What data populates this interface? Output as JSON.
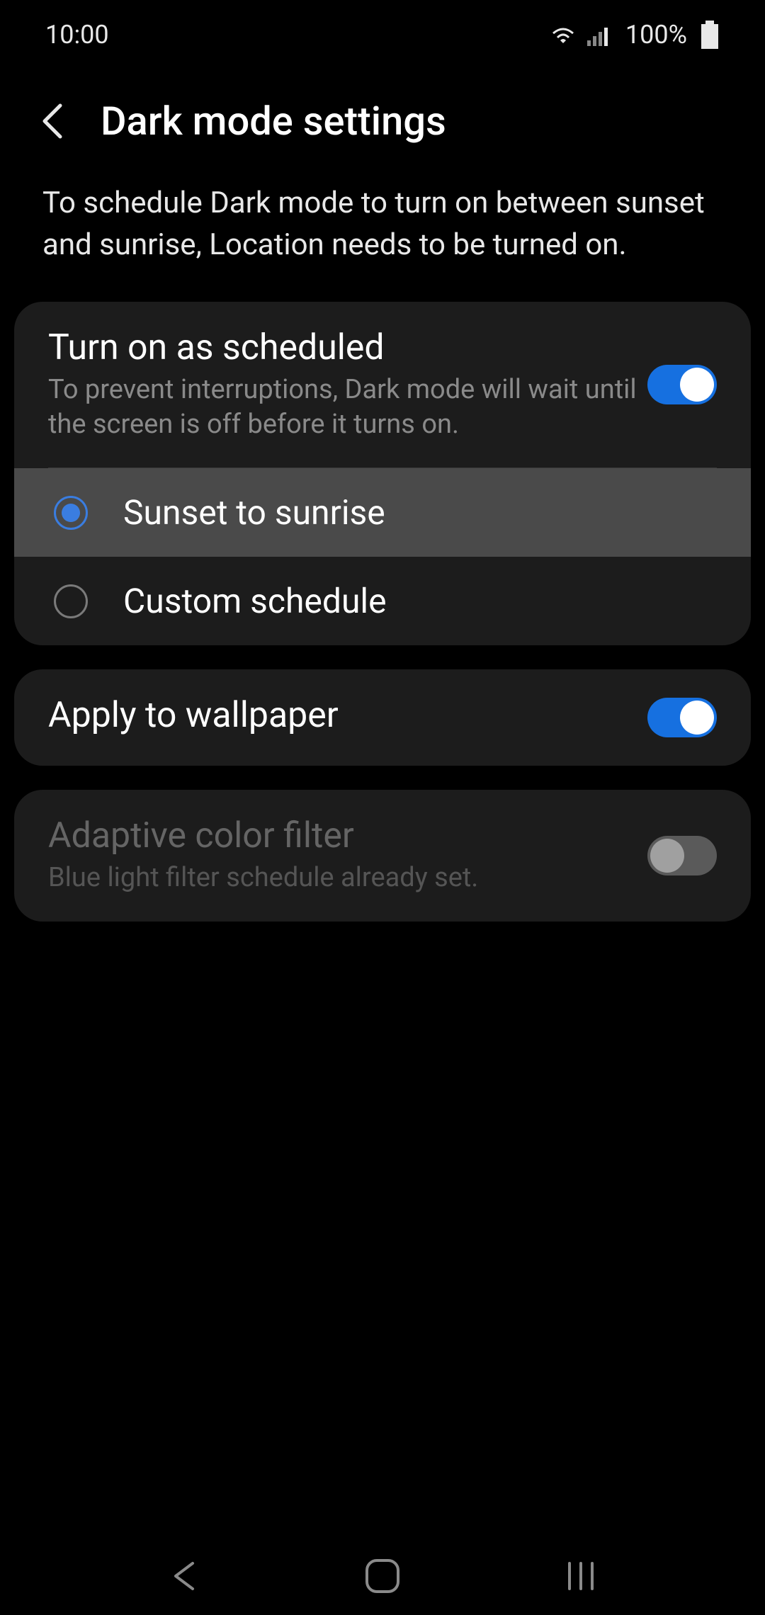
{
  "statusBar": {
    "time": "10:00",
    "battery": "100%"
  },
  "header": {
    "title": "Dark mode settings"
  },
  "info": {
    "text": "To schedule Dark mode to turn on between sunset and sunrise, Location needs to be turned on."
  },
  "scheduleCard": {
    "title": "Turn on as scheduled",
    "subtitle": "To prevent interruptions, Dark mode will wait until the screen is off before it turns on.",
    "enabled": true,
    "options": {
      "sunsetSunrise": {
        "label": "Sunset to sunrise",
        "selected": true
      },
      "customSchedule": {
        "label": "Custom schedule",
        "selected": false
      }
    }
  },
  "wallpaperCard": {
    "title": "Apply to wallpaper",
    "enabled": true
  },
  "adaptiveCard": {
    "title": "Adaptive color filter",
    "subtitle": "Blue light filter schedule already set.",
    "enabled": false
  }
}
